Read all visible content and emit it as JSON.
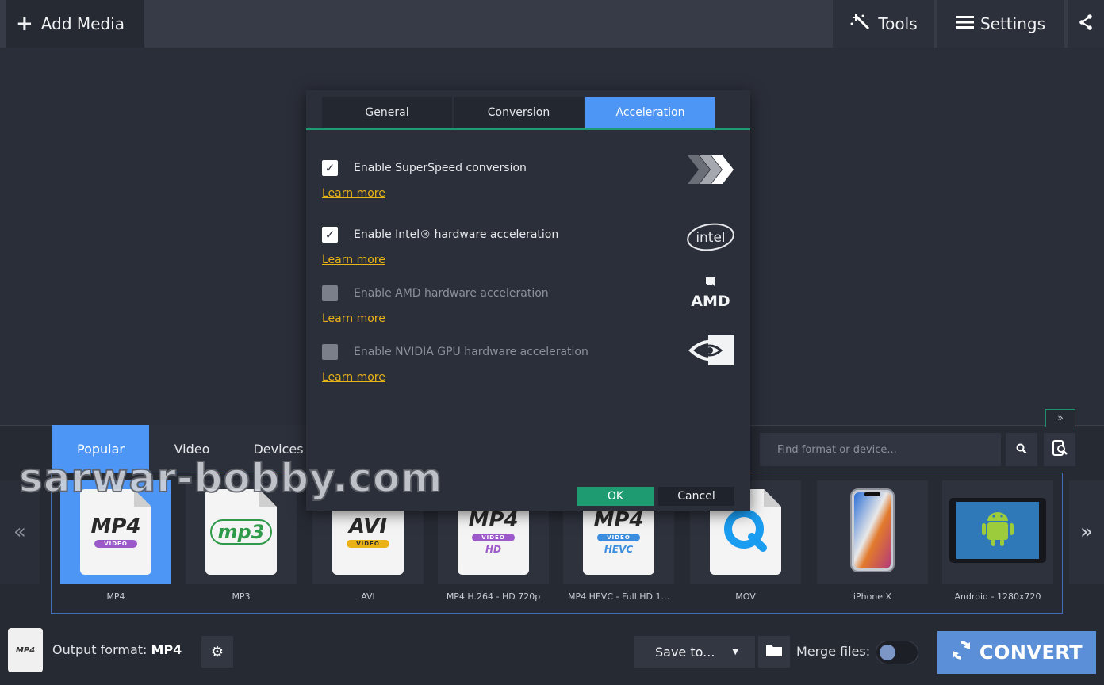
{
  "topbar": {
    "add_media_label": "Add Media",
    "tools_label": "Tools",
    "settings_label": "Settings"
  },
  "dialog": {
    "tabs": [
      "General",
      "Conversion",
      "Acceleration"
    ],
    "active_tab": "Acceleration",
    "options": [
      {
        "label": "Enable SuperSpeed conversion",
        "checked": true,
        "enabled": true,
        "learn_more": "Learn more",
        "logo": "superspeed-icon"
      },
      {
        "label": "Enable Intel® hardware acceleration",
        "checked": true,
        "enabled": true,
        "learn_more": "Learn more",
        "logo": "intel-logo"
      },
      {
        "label": "Enable AMD hardware acceleration",
        "checked": false,
        "enabled": false,
        "learn_more": "Learn more",
        "logo": "amd-logo"
      },
      {
        "label": "Enable NVIDIA GPU hardware acceleration",
        "checked": false,
        "enabled": false,
        "learn_more": "Learn more",
        "logo": "nvidia-logo"
      }
    ],
    "intel_logo_text": "intel",
    "amd_logo_text": "AMD",
    "ok_label": "OK",
    "cancel_label": "Cancel"
  },
  "formats": {
    "tabs": [
      "Popular",
      "Video",
      "Devices"
    ],
    "active_tab": "Popular",
    "search_placeholder": "Find format or device...",
    "cards": [
      {
        "label": "MP4",
        "icon_text": "MP4",
        "pill": "VIDEO",
        "sub": "",
        "selected": true
      },
      {
        "label": "MP3",
        "icon_text": "mp3",
        "pill": "",
        "sub": "",
        "selected": false
      },
      {
        "label": "AVI",
        "icon_text": "AVI",
        "pill": "VIDEO",
        "sub": "",
        "selected": false
      },
      {
        "label": "MP4 H.264 - HD 720p",
        "icon_text": "MP4",
        "pill": "VIDEO",
        "sub": "HD",
        "selected": false
      },
      {
        "label": "MP4 HEVC - Full HD 1...",
        "icon_text": "MP4",
        "pill": "VIDEO",
        "sub": "HEVC",
        "selected": false
      },
      {
        "label": "MOV",
        "icon_text": "",
        "pill": "",
        "sub": "",
        "selected": false
      },
      {
        "label": "iPhone X",
        "icon_text": "",
        "pill": "",
        "sub": "",
        "selected": false
      },
      {
        "label": "Android - 1280x720",
        "icon_text": "",
        "pill": "",
        "sub": "",
        "selected": false
      }
    ]
  },
  "bottombar": {
    "output_icon_text": "MP4",
    "output_prefix": "Output format:",
    "output_value": "MP4",
    "save_to_label": "Save to...",
    "merge_label": "Merge files:",
    "merge_on": false,
    "convert_label": "CONVERT"
  },
  "watermark": "sarwar-bobby.com",
  "colors": {
    "accent_blue": "#4d96f5",
    "ok_green": "#1f9b71",
    "learn_link": "#e9b318",
    "convert_blue": "#5b8fd7"
  }
}
